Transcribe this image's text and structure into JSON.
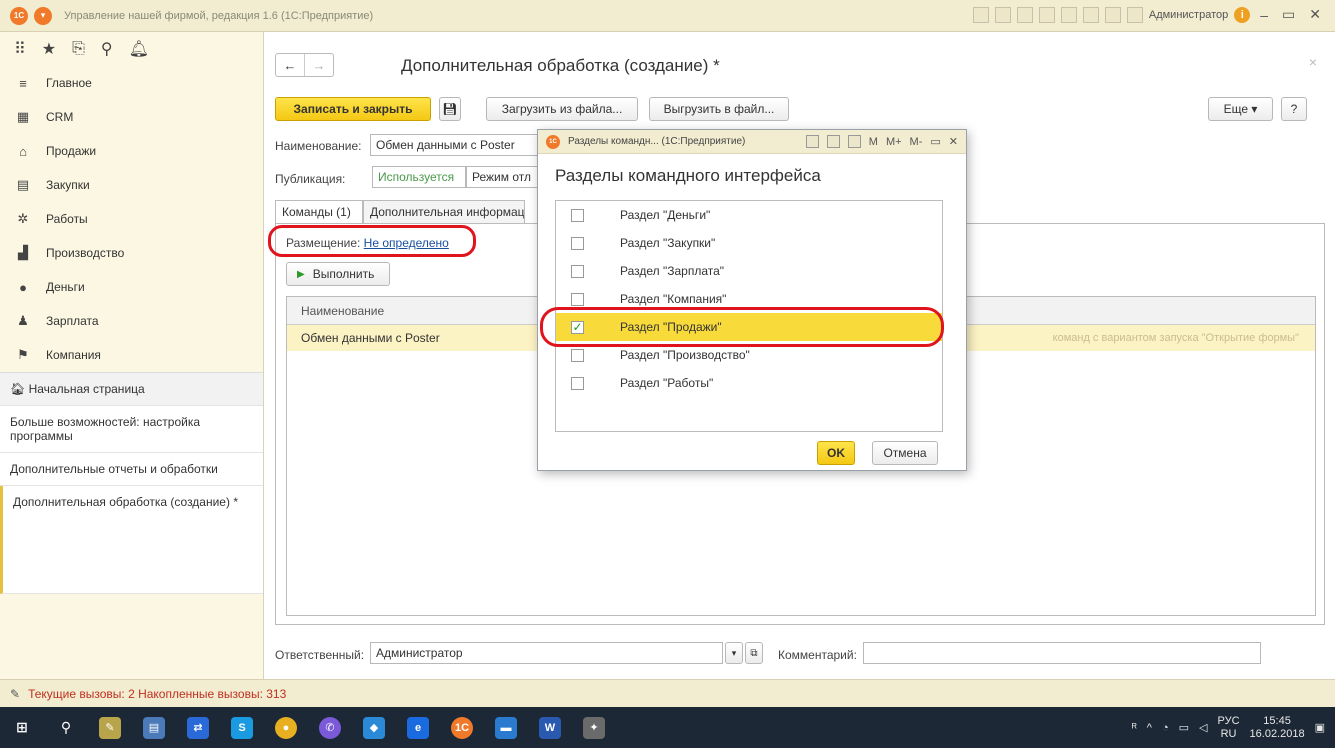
{
  "window": {
    "title": "Управление нашей фирмой, редакция 1.6 (1С:Предприятие)",
    "user": "Администратор"
  },
  "sidebar": {
    "sections": [
      {
        "label": "Главное",
        "icon": "menu-icon"
      },
      {
        "label": "CRM",
        "icon": "crm-icon"
      },
      {
        "label": "Продажи",
        "icon": "cart-icon"
      },
      {
        "label": "Закупки",
        "icon": "purchase-icon"
      },
      {
        "label": "Работы",
        "icon": "tools-icon"
      },
      {
        "label": "Производство",
        "icon": "factory-icon"
      },
      {
        "label": "Деньги",
        "icon": "money-icon"
      },
      {
        "label": "Зарплата",
        "icon": "salary-icon"
      },
      {
        "label": "Компания",
        "icon": "flag-icon"
      }
    ],
    "home": "Начальная страница",
    "links": [
      "Больше возможностей: настройка программы",
      "Дополнительные отчеты и обработки",
      "Дополнительная обработка (создание) *"
    ]
  },
  "form": {
    "title": "Дополнительная обработка (создание) *",
    "btn_save_close": "Записать и закрыть",
    "btn_load": "Загрузить из файла...",
    "btn_export": "Выгрузить в файл...",
    "btn_more": "Еще",
    "btn_help": "?",
    "name_label": "Наименование:",
    "name_value": "Обмен данными с Poster",
    "publication_label": "Публикация:",
    "publication_used": "Используется",
    "publication_mode": "Режим отл",
    "tabs": [
      "Команды (1)",
      "Дополнительная информация"
    ],
    "placement_label": "Размещение:",
    "placement_value": "Не определено",
    "run_button": "Выполнить",
    "table_header": "Наименование",
    "table_row": "Обмен данными с Poster",
    "table_row_hint": "команд с вариантом запуска \"Открытие формы\"",
    "responsible_label": "Ответственный:",
    "responsible_value": "Администратор",
    "comment_label": "Комментарий:"
  },
  "dialog": {
    "window_title": "Разделы командн... (1С:Предприятие)",
    "heading": "Разделы командного интерфейса",
    "items": [
      {
        "label": "Раздел \"Деньги\"",
        "checked": false
      },
      {
        "label": "Раздел \"Закупки\"",
        "checked": false
      },
      {
        "label": "Раздел \"Зарплата\"",
        "checked": false
      },
      {
        "label": "Раздел \"Компания\"",
        "checked": false
      },
      {
        "label": "Раздел \"Продажи\"",
        "checked": true
      },
      {
        "label": "Раздел \"Производство\"",
        "checked": false
      },
      {
        "label": "Раздел \"Работы\"",
        "checked": false
      }
    ],
    "ok": "OK",
    "cancel": "Отмена"
  },
  "status": {
    "text": "Текущие вызовы: 2   Накопленные вызовы: 313"
  },
  "taskbar": {
    "lang_top": "РУС",
    "lang_bottom": "RU",
    "time": "15:45",
    "date": "16.02.2018"
  }
}
